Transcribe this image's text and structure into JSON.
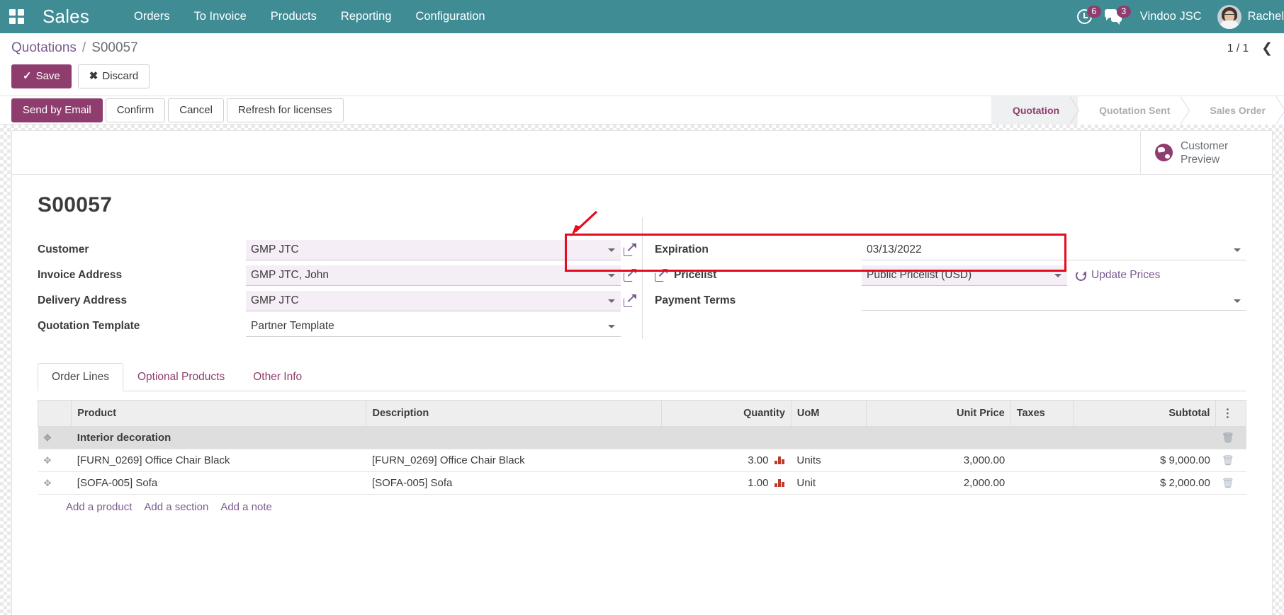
{
  "navbar": {
    "apps_icon": "apps-grid-icon",
    "brand": "Sales",
    "menu": [
      "Orders",
      "To Invoice",
      "Products",
      "Reporting",
      "Configuration"
    ],
    "activity_icon": "clock-icon",
    "activity_count": "6",
    "messages_icon": "chat-bubbles-icon",
    "messages_count": "3",
    "company": "Vindoo JSC",
    "user": "Rachel",
    "bg_color": "#3f8c95",
    "badge_color": "#8f3d6e"
  },
  "breadcrumb": {
    "root": "Quotations",
    "separator": "/",
    "current": "S00057"
  },
  "pager": {
    "count": "1 / 1",
    "prev_icon": "chevron-left-icon"
  },
  "edit_buttons": {
    "save": "Save",
    "save_icon": "check-icon",
    "discard": "Discard",
    "discard_icon": "times-icon"
  },
  "action_buttons": [
    {
      "label": "Send by Email",
      "primary": true
    },
    {
      "label": "Confirm",
      "primary": false
    },
    {
      "label": "Cancel",
      "primary": false
    },
    {
      "label": "Refresh for licenses",
      "primary": false
    }
  ],
  "statusbar": {
    "stages": [
      "Quotation",
      "Quotation Sent",
      "Sales Order"
    ],
    "active": "Quotation",
    "active_color": "#8f3d6e"
  },
  "stat_button": {
    "icon": "globe-icon",
    "line1": "Customer",
    "line2": "Preview"
  },
  "record": {
    "title": "S00057"
  },
  "form": {
    "left": [
      {
        "label": "Customer",
        "value": "GMP JTC",
        "has_dropdown": true,
        "has_external_link": true,
        "highlight": true
      },
      {
        "label": "Invoice Address",
        "value": "GMP JTC, John",
        "has_dropdown": true,
        "has_external_link": true,
        "highlight": true
      },
      {
        "label": "Delivery Address",
        "value": "GMP JTC",
        "has_dropdown": true,
        "has_external_link": true,
        "highlight": true
      },
      {
        "label": "Quotation Template",
        "value": "Partner Template",
        "has_dropdown": true,
        "has_external_link": false,
        "highlight": false
      }
    ],
    "right": [
      {
        "label": "Expiration",
        "value": "03/13/2022",
        "has_dropdown": true,
        "has_external_link": false,
        "highlight": false
      },
      {
        "label": "Pricelist",
        "value": "Public Pricelist (USD)",
        "has_dropdown": true,
        "has_external_link": true,
        "highlight": true,
        "extra_link": "Update Prices",
        "extra_icon": "refresh-icon"
      },
      {
        "label": "Payment Terms",
        "value": "",
        "has_dropdown": true,
        "has_external_link": false,
        "highlight": false
      }
    ]
  },
  "annotation": {
    "type": "red-highlight-box",
    "color": "#e30d1f",
    "target": "Expiration",
    "arrow_icon": "arrow-pointer-icon"
  },
  "notebook": {
    "tabs": [
      {
        "label": "Order Lines",
        "active": true
      },
      {
        "label": "Optional Products",
        "active": false
      },
      {
        "label": "Other Info",
        "active": false
      }
    ]
  },
  "order_lines": {
    "columns": [
      "Product",
      "Description",
      "Quantity",
      "UoM",
      "Unit Price",
      "Taxes",
      "Subtotal"
    ],
    "options_icon": "column-options-icon",
    "rows": [
      {
        "type": "section",
        "handle_icon": "drag-handle-icon",
        "product": "Interior decoration",
        "description": "",
        "quantity": "",
        "uom": "",
        "unit_price": "",
        "taxes": "",
        "subtotal": "",
        "delete_icon": "trash-icon"
      },
      {
        "type": "line",
        "handle_icon": "drag-handle-icon",
        "product": "[FURN_0269] Office Chair Black",
        "description": "[FURN_0269] Office Chair Black",
        "quantity": "3.00",
        "quantity_icon": "chart-bars-icon",
        "uom": "Units",
        "unit_price": "3,000.00",
        "taxes": "",
        "subtotal": "$ 9,000.00",
        "delete_icon": "trash-icon"
      },
      {
        "type": "line",
        "handle_icon": "drag-handle-icon",
        "product": "[SOFA-005] Sofa",
        "description": "[SOFA-005] Sofa",
        "quantity": "1.00",
        "quantity_icon": "chart-bars-icon",
        "uom": "Unit",
        "unit_price": "2,000.00",
        "taxes": "",
        "subtotal": "$ 2,000.00",
        "delete_icon": "trash-icon"
      }
    ],
    "add_links": [
      "Add a product",
      "Add a section",
      "Add a note"
    ]
  }
}
